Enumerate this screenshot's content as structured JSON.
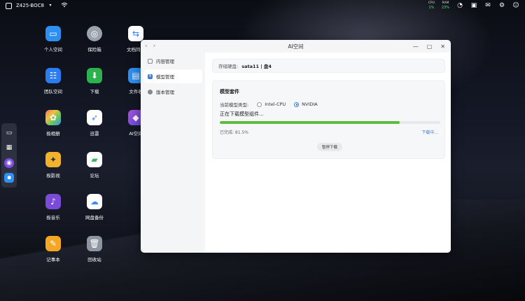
{
  "topbar": {
    "device_name": "Z425-BOC8",
    "stats": [
      {
        "label": "CPU",
        "value": "1%"
      },
      {
        "label": "RAM",
        "value": "23%"
      }
    ]
  },
  "desktop": {
    "icons": [
      {
        "label": "个人空间",
        "icon": "folder-icon",
        "color": "#2e8ff0"
      },
      {
        "label": "保险箱",
        "icon": "safe-icon",
        "color": "#9aa3ad"
      },
      {
        "label": "文档同步",
        "icon": "sync-icon",
        "color": "#2d86f5"
      },
      {
        "label": "团队空间",
        "icon": "team-icon",
        "color": "#2b7cf0"
      },
      {
        "label": "下载",
        "icon": "download-icon",
        "color": "#2bb24c"
      },
      {
        "label": "文件收",
        "icon": "inbox-icon",
        "color": "#2f8ff2"
      },
      {
        "label": "极相册",
        "icon": "photos-icon",
        "color": "#f0a23a"
      },
      {
        "label": "迅雷",
        "icon": "thunder-icon",
        "color": "#3a86f5"
      },
      {
        "label": "AI空间",
        "icon": "ai-icon",
        "color": "#7c4fe0"
      },
      {
        "label": "极影视",
        "icon": "video-icon",
        "color": "#f2b22b"
      },
      {
        "label": "论坛",
        "icon": "forum-icon",
        "color": "#3bb86a"
      },
      {
        "label": "极音乐",
        "icon": "music-icon",
        "color": "#7a4ad8"
      },
      {
        "label": "网盘备份",
        "icon": "cloud-backup-icon",
        "color": "#3a8ff5"
      },
      {
        "label": "记事本",
        "icon": "notepad-icon",
        "color": "#f5a623"
      },
      {
        "label": "回收站",
        "icon": "trash-icon",
        "color": "#8d96a0"
      }
    ]
  },
  "window": {
    "title": "AI空间",
    "sidebar": [
      {
        "label": "内容管理",
        "active": false
      },
      {
        "label": "模型管理",
        "active": true
      },
      {
        "label": "版本管理",
        "active": false
      }
    ],
    "storage": {
      "label": "存储硬盘:",
      "value": "sata11 | 盘4"
    },
    "model_suite": {
      "title": "模型套件",
      "type_label": "当前模型类型:",
      "options": [
        "Intel-CPU",
        "NVIDIA"
      ],
      "selected": "NVIDIA",
      "status": "正在下载模型组件...",
      "progress": 81.5,
      "done_label": "已完成: 81.5%",
      "downloading_label": "下载中...",
      "pause_label": "暂停下载"
    }
  },
  "colors": {
    "accent": "#3a7bd5",
    "progress": "#5cbd3d"
  }
}
